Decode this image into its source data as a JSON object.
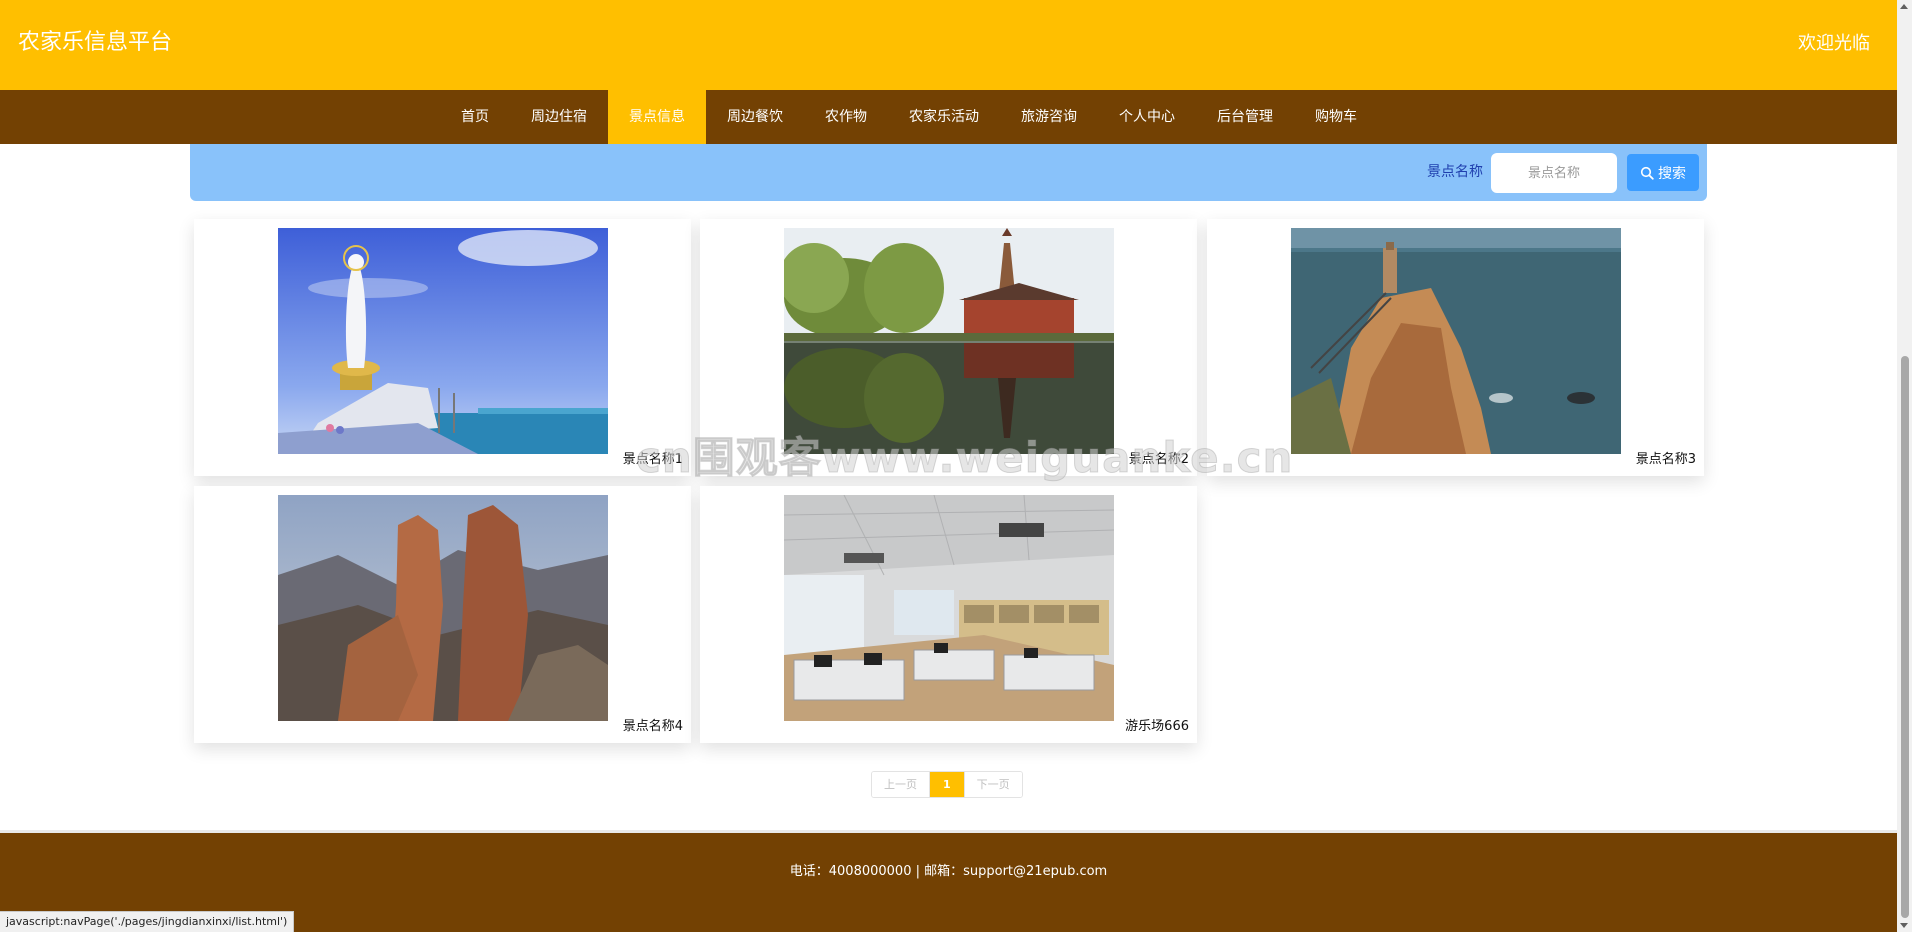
{
  "header": {
    "site_title": "农家乐信息平台",
    "welcome": "欢迎光临"
  },
  "nav": {
    "items": [
      {
        "label": "首页",
        "active": false
      },
      {
        "label": "周边住宿",
        "active": false
      },
      {
        "label": "景点信息",
        "active": true
      },
      {
        "label": "周边餐饮",
        "active": false
      },
      {
        "label": "农作物",
        "active": false
      },
      {
        "label": "农家乐活动",
        "active": false
      },
      {
        "label": "旅游咨询",
        "active": false
      },
      {
        "label": "个人中心",
        "active": false
      },
      {
        "label": "后台管理",
        "active": false
      },
      {
        "label": "购物车",
        "active": false
      }
    ]
  },
  "search": {
    "label": "景点名称",
    "placeholder": "景点名称",
    "value": "",
    "button_label": "搜索"
  },
  "cards": [
    {
      "caption": "景点名称1",
      "image": "guanyin-statue-by-sea"
    },
    {
      "caption": "景点名称2",
      "image": "pagoda-reflection-lake"
    },
    {
      "caption": "景点名称3",
      "image": "sea-cliff-stone-tower"
    },
    {
      "caption": "景点名称4",
      "image": "rock-pillars-mountains"
    },
    {
      "caption": "游乐场666",
      "image": "office-cubicles"
    }
  ],
  "pagination": {
    "prev_label": "上一页",
    "current_page": "1",
    "next_label": "下一页"
  },
  "footer": {
    "text": "电话：4008000000 | 邮箱：support@21epub.com"
  },
  "status_bar": {
    "text": "javascript:navPage('./pages/jingdianxinxi/list.html')"
  },
  "watermark": {
    "text": "cn围观客www.weiguanke.cn"
  },
  "colors": {
    "header_bg": "#ffbf00",
    "nav_bg": "#734103",
    "nav_active_bg": "#ffbf00",
    "search_bar_bg": "#89c2fa",
    "search_button_bg": "#3b9cff",
    "footer_bg": "#734103"
  }
}
